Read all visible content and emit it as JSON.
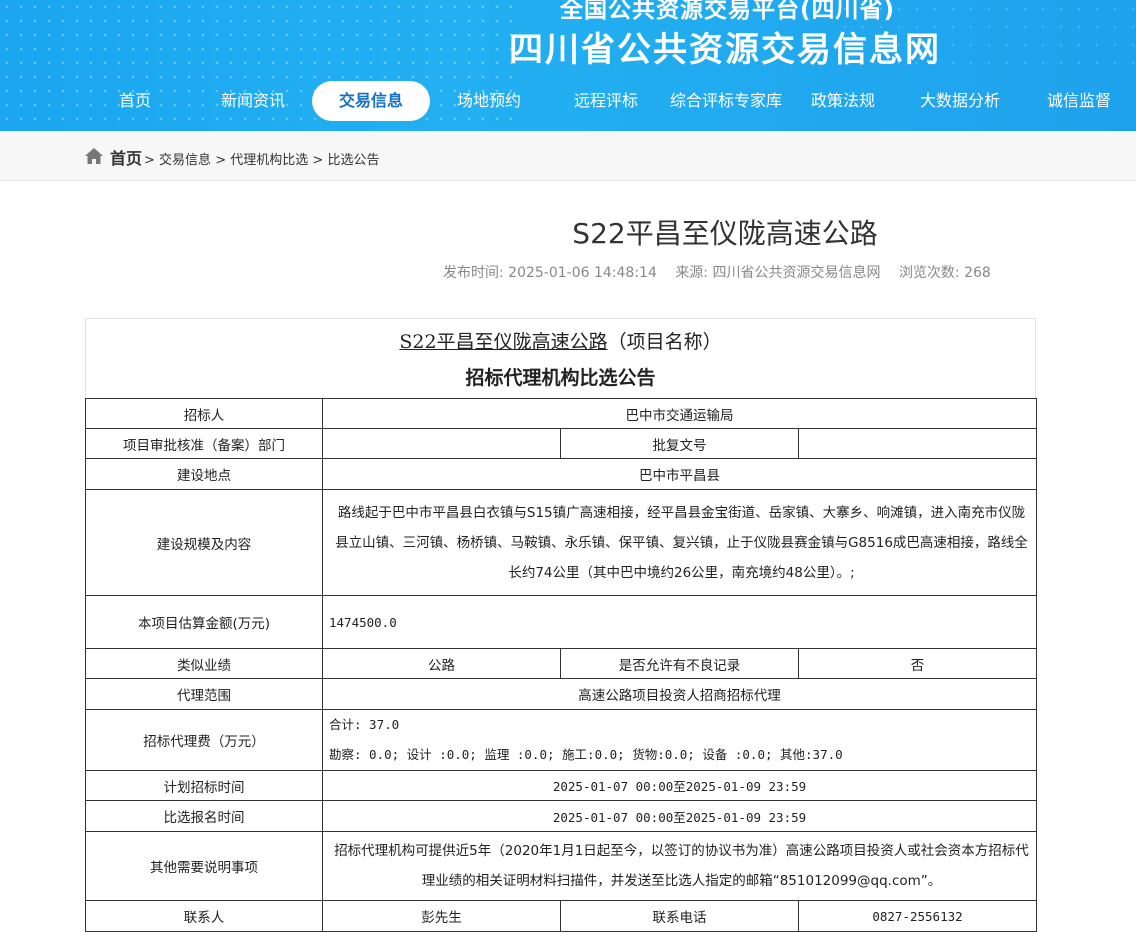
{
  "header": {
    "subtitle": "全国公共资源交易平台(四川省)",
    "title": "四川省公共资源交易信息网"
  },
  "nav": {
    "items": [
      {
        "label": "首页",
        "active": false
      },
      {
        "label": "新闻资讯",
        "active": false
      },
      {
        "label": "交易信息",
        "active": true
      },
      {
        "label": "场地预约",
        "active": false
      },
      {
        "label": "远程评标",
        "active": false
      },
      {
        "label": "综合评标专家库",
        "active": false
      },
      {
        "label": "政策法规",
        "active": false
      },
      {
        "label": "大数据分析",
        "active": false
      },
      {
        "label": "诚信监督",
        "active": false
      }
    ]
  },
  "breadcrumb": {
    "home": "首页",
    "sep": ">",
    "items": [
      "交易信息",
      "代理机构比选",
      "比选公告"
    ]
  },
  "article": {
    "title": "S22平昌至仪陇高速公路",
    "publish_label": "发布时间: 2025-01-06 14:48:14",
    "source_label": "来源: 四川省公共资源交易信息网",
    "views_label": "浏览次数: 268"
  },
  "notice": {
    "project_name": "S22平昌至仪陇高速公路",
    "project_suffix": "（项目名称）",
    "heading": "招标代理机构比选公告"
  },
  "table": {
    "tenderer_label": "招标人",
    "tenderer_value": "巴中市交通运输局",
    "approval_dept_label": "项目审批核准（备案）部门",
    "approval_dept_value": "",
    "approval_no_label": "批复文号",
    "approval_no_value": "",
    "location_label": "建设地点",
    "location_value": "巴中市平昌县",
    "scale_label": "建设规模及内容",
    "scale_value": "路线起于巴中市平昌县白衣镇与S15镇广高速相接，经平昌县金宝街道、岳家镇、大寨乡、响滩镇，进入南充市仪陇县立山镇、三河镇、杨桥镇、马鞍镇、永乐镇、保平镇、复兴镇，止于仪陇县赛金镇与G8516成巴高速相接，路线全长约74公里（其中巴中境约26公里，南充境约48公里）。;",
    "amount_label": "本项目估算金额(万元)",
    "amount_value": "1474500.0",
    "similar_label": "类似业绩",
    "similar_value": "公路",
    "bad_record_label": "是否允许有不良记录",
    "bad_record_value": "否",
    "scope_label": "代理范围",
    "scope_value": "高速公路项目投资人招商招标代理",
    "fee_label": "招标代理费（万元）",
    "fee_total": "合计: 37.0",
    "fee_detail": "勘察: 0.0; 设计 :0.0; 监理 :0.0; 施工:0.0; 货物:0.0; 设备 :0.0; 其他:37.0",
    "plan_time_label": "计划招标时间",
    "plan_time_value": "2025-01-07 00:00至2025-01-09 23:59",
    "signup_time_label": "比选报名时间",
    "signup_time_value": "2025-01-07 00:00至2025-01-09 23:59",
    "other_label": "其他需要说明事项",
    "other_value": "招标代理机构可提供近5年（2020年1月1日起至今，以签订的协议书为准）高速公路项目投资人或社会资本方招标代理业绩的相关证明材料扫描件，并发送至比选人指定的邮箱“851012099@qq.com”。",
    "contact_label": "联系人",
    "contact_value": "彭先生",
    "phone_label": "联系电话",
    "phone_value": "0827-2556132"
  }
}
